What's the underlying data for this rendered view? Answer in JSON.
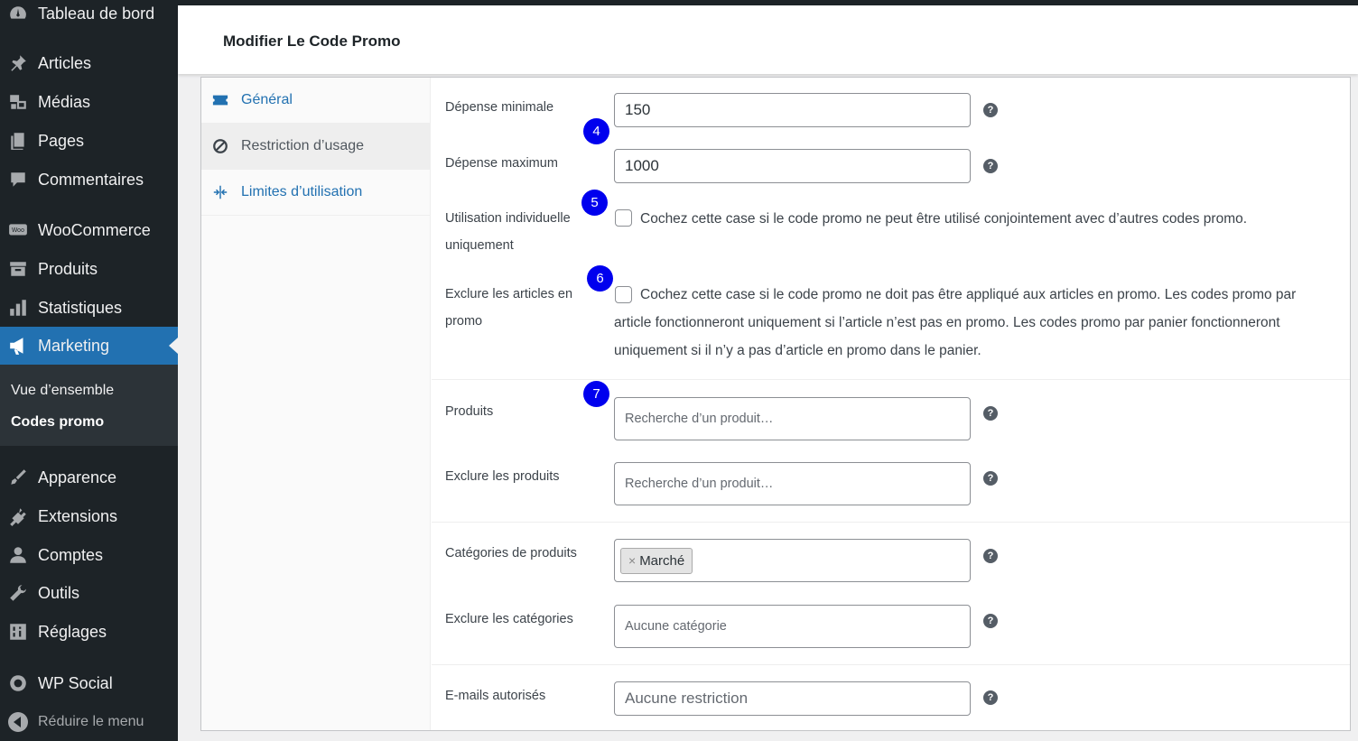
{
  "sidebar": {
    "items": [
      {
        "label": "Tableau de bord",
        "icon": "dashboard-icon"
      },
      {
        "label": "Articles",
        "icon": "pin-icon"
      },
      {
        "label": "Médias",
        "icon": "media-icon"
      },
      {
        "label": "Pages",
        "icon": "pages-icon"
      },
      {
        "label": "Commentaires",
        "icon": "comment-icon"
      },
      {
        "label": "WooCommerce",
        "icon": "woo-icon"
      },
      {
        "label": "Produits",
        "icon": "archive-icon"
      },
      {
        "label": "Statistiques",
        "icon": "chart-icon"
      },
      {
        "label": "Marketing",
        "icon": "megaphone-icon"
      },
      {
        "label": "Apparence",
        "icon": "brush-icon"
      },
      {
        "label": "Extensions",
        "icon": "plugin-icon"
      },
      {
        "label": "Comptes",
        "icon": "user-icon"
      },
      {
        "label": "Outils",
        "icon": "wrench-icon"
      },
      {
        "label": "Réglages",
        "icon": "settings-icon"
      },
      {
        "label": "WP Social",
        "icon": "social-icon"
      }
    ],
    "submenu": [
      "Vue d’ensemble",
      "Codes promo"
    ],
    "collapse_label": "Réduire le menu"
  },
  "header": {
    "title": "Modifier Le Code Promo"
  },
  "tabs": [
    {
      "label": "Général",
      "icon": "ticket-icon"
    },
    {
      "label": "Restriction d’usage",
      "icon": "block-icon"
    },
    {
      "label": "Limites d’utilisation",
      "icon": "arrows-in-icon"
    }
  ],
  "form": {
    "min_spend": {
      "label": "Dépense minimale",
      "value": "150"
    },
    "max_spend": {
      "label": "Dépense maximum",
      "value": "1000"
    },
    "individual_use": {
      "label": "Utilisation individuelle uniquement",
      "description": "Cochez cette case si le code promo ne peut être utilisé conjointement avec d’autres codes promo.",
      "checked": false
    },
    "exclude_sale": {
      "label": "Exclure les articles en promo",
      "description": "Cochez cette case si le code promo ne doit pas être appliqué aux articles en promo. Les codes promo par article fonctionneront uniquement si l’article n’est pas en promo. Les codes promo par panier fonctionneront uniquement si il n’y a pas d’article en promo dans le panier.",
      "checked": false
    },
    "products": {
      "label": "Produits",
      "placeholder": "Recherche d’un produit…"
    },
    "exclude_products": {
      "label": "Exclure les produits",
      "placeholder": "Recherche d’un produit…"
    },
    "categories": {
      "label": "Catégories de produits",
      "chip": "Marché",
      "chip_remove": "×"
    },
    "exclude_categories": {
      "label": "Exclure les catégories",
      "placeholder": "Aucune catégorie"
    },
    "emails": {
      "label": "E-mails autorisés",
      "placeholder": "Aucune restriction"
    }
  },
  "help_glyph": "?",
  "markers": [
    "4",
    "5",
    "6",
    "7"
  ],
  "colors": {
    "sidebar": "#1d2327",
    "active": "#2271b1",
    "marker": "#0000ee"
  }
}
